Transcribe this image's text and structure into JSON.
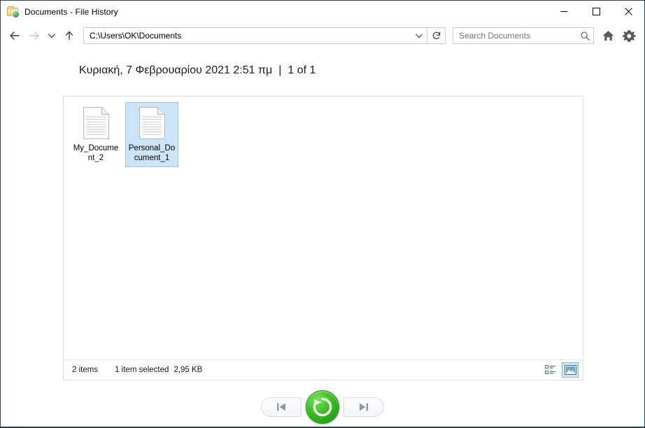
{
  "window": {
    "title": "Documents - File History",
    "icon": "folder-history-icon",
    "controls": {
      "minimize_label": "Minimize",
      "maximize_label": "Maximize",
      "close_label": "Close"
    }
  },
  "toolbar": {
    "back_label": "Back",
    "forward_label": "Forward",
    "recent_label": "Recent locations",
    "up_label": "Up",
    "path": "C:\\Users\\OK\\Documents",
    "path_dropdown_label": "Previous locations",
    "refresh_label": "Refresh",
    "search_placeholder": "Search Documents",
    "search_value": "",
    "home_label": "Home",
    "settings_label": "Settings"
  },
  "heading": {
    "date": "Κυριακή, 7 Φεβρουαρίου 2021 2:51 πμ",
    "separator": "|",
    "counter": "1 of 1"
  },
  "files": [
    {
      "name": "My_Document_2",
      "label": "My_Document_2",
      "icon": "document-icon",
      "selected": false
    },
    {
      "name": "Personal_Document_1",
      "label": "Personal_Document_1",
      "icon": "document-icon",
      "selected": true
    }
  ],
  "statusbar": {
    "items_count": "2 items",
    "selection": "1 item selected",
    "size": "2,95 KB",
    "details_view_label": "Details view",
    "large_icons_view_label": "Large icons view",
    "active_view": "large-icons"
  },
  "player": {
    "previous_label": "Previous version",
    "restore_label": "Restore to original location",
    "next_label": "Next version"
  },
  "colors": {
    "window_border": "#2b4450",
    "selection_fill": "#cce4f7",
    "selection_border": "#9fc8e8",
    "restore_green": "#3fc427",
    "panel_border": "#dedede",
    "placeholder_text": "#767676"
  }
}
